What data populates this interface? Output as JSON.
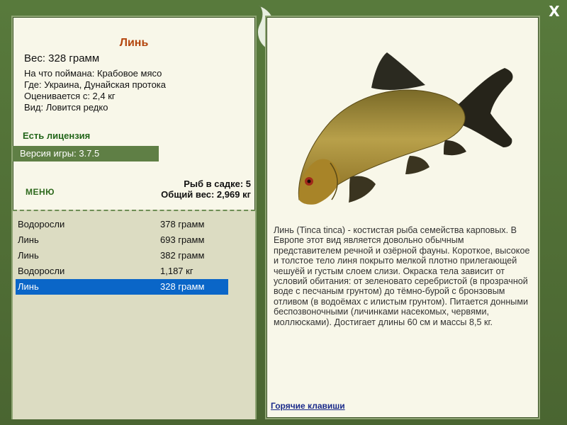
{
  "fish": {
    "name": "Линь",
    "weight": "Вес: 328 грамм",
    "info": [
      "На что поймана: Крабовое мясо",
      "Где: Украина, Дунайская протока",
      "Оценивается с: 2,4 кг",
      "Вид: Ловится редко"
    ]
  },
  "license": "Есть лицензия",
  "version": "Версия игры: 3.7.5",
  "menu_label": "МЕНЮ",
  "net": {
    "count": "Рыб в садке: 5",
    "total": "Общий вес: 2,969 кг"
  },
  "catch_list": [
    {
      "name": "Водоросли",
      "weight": "378 грамм"
    },
    {
      "name": "Линь",
      "weight": "693 грамм"
    },
    {
      "name": "Линь",
      "weight": "382 грамм"
    },
    {
      "name": "Водоросли",
      "weight": "1,187 кг"
    },
    {
      "name": "Линь",
      "weight": "328 грамм"
    }
  ],
  "selected_index": 4,
  "description": "Линь (Tinca tinca) - костистая рыба семейства карповых. В Европе этот вид является довольно обычным представителем речной и озёрной фауны. Короткое, высокое и толстое тело линя покрыто мелкой плотно прилегающей чешуёй и густым слоем слизи. Окраска тела зависит от условий обитания: от зеленовато серебристой (в прозрачной воде с песчаным грунтом) до тёмно-бурой с бронзовым отливом (в водоёмах с илистым грунтом). Питается донными беспозвоночными (личинками насекомых, червями, моллюсками). Достигает длины 60 см и массы 8,5 кг.",
  "hotkeys_label": "Горячие клавиши",
  "close_label": "X",
  "colors": {
    "frame": "#4e6a34",
    "panel": "#f8f7e9",
    "title": "#b4460e",
    "license": "#23661a",
    "selected_row": "#0a66c8"
  },
  "icons": {
    "close": "close-icon",
    "logo": "fish-logo-icon"
  }
}
